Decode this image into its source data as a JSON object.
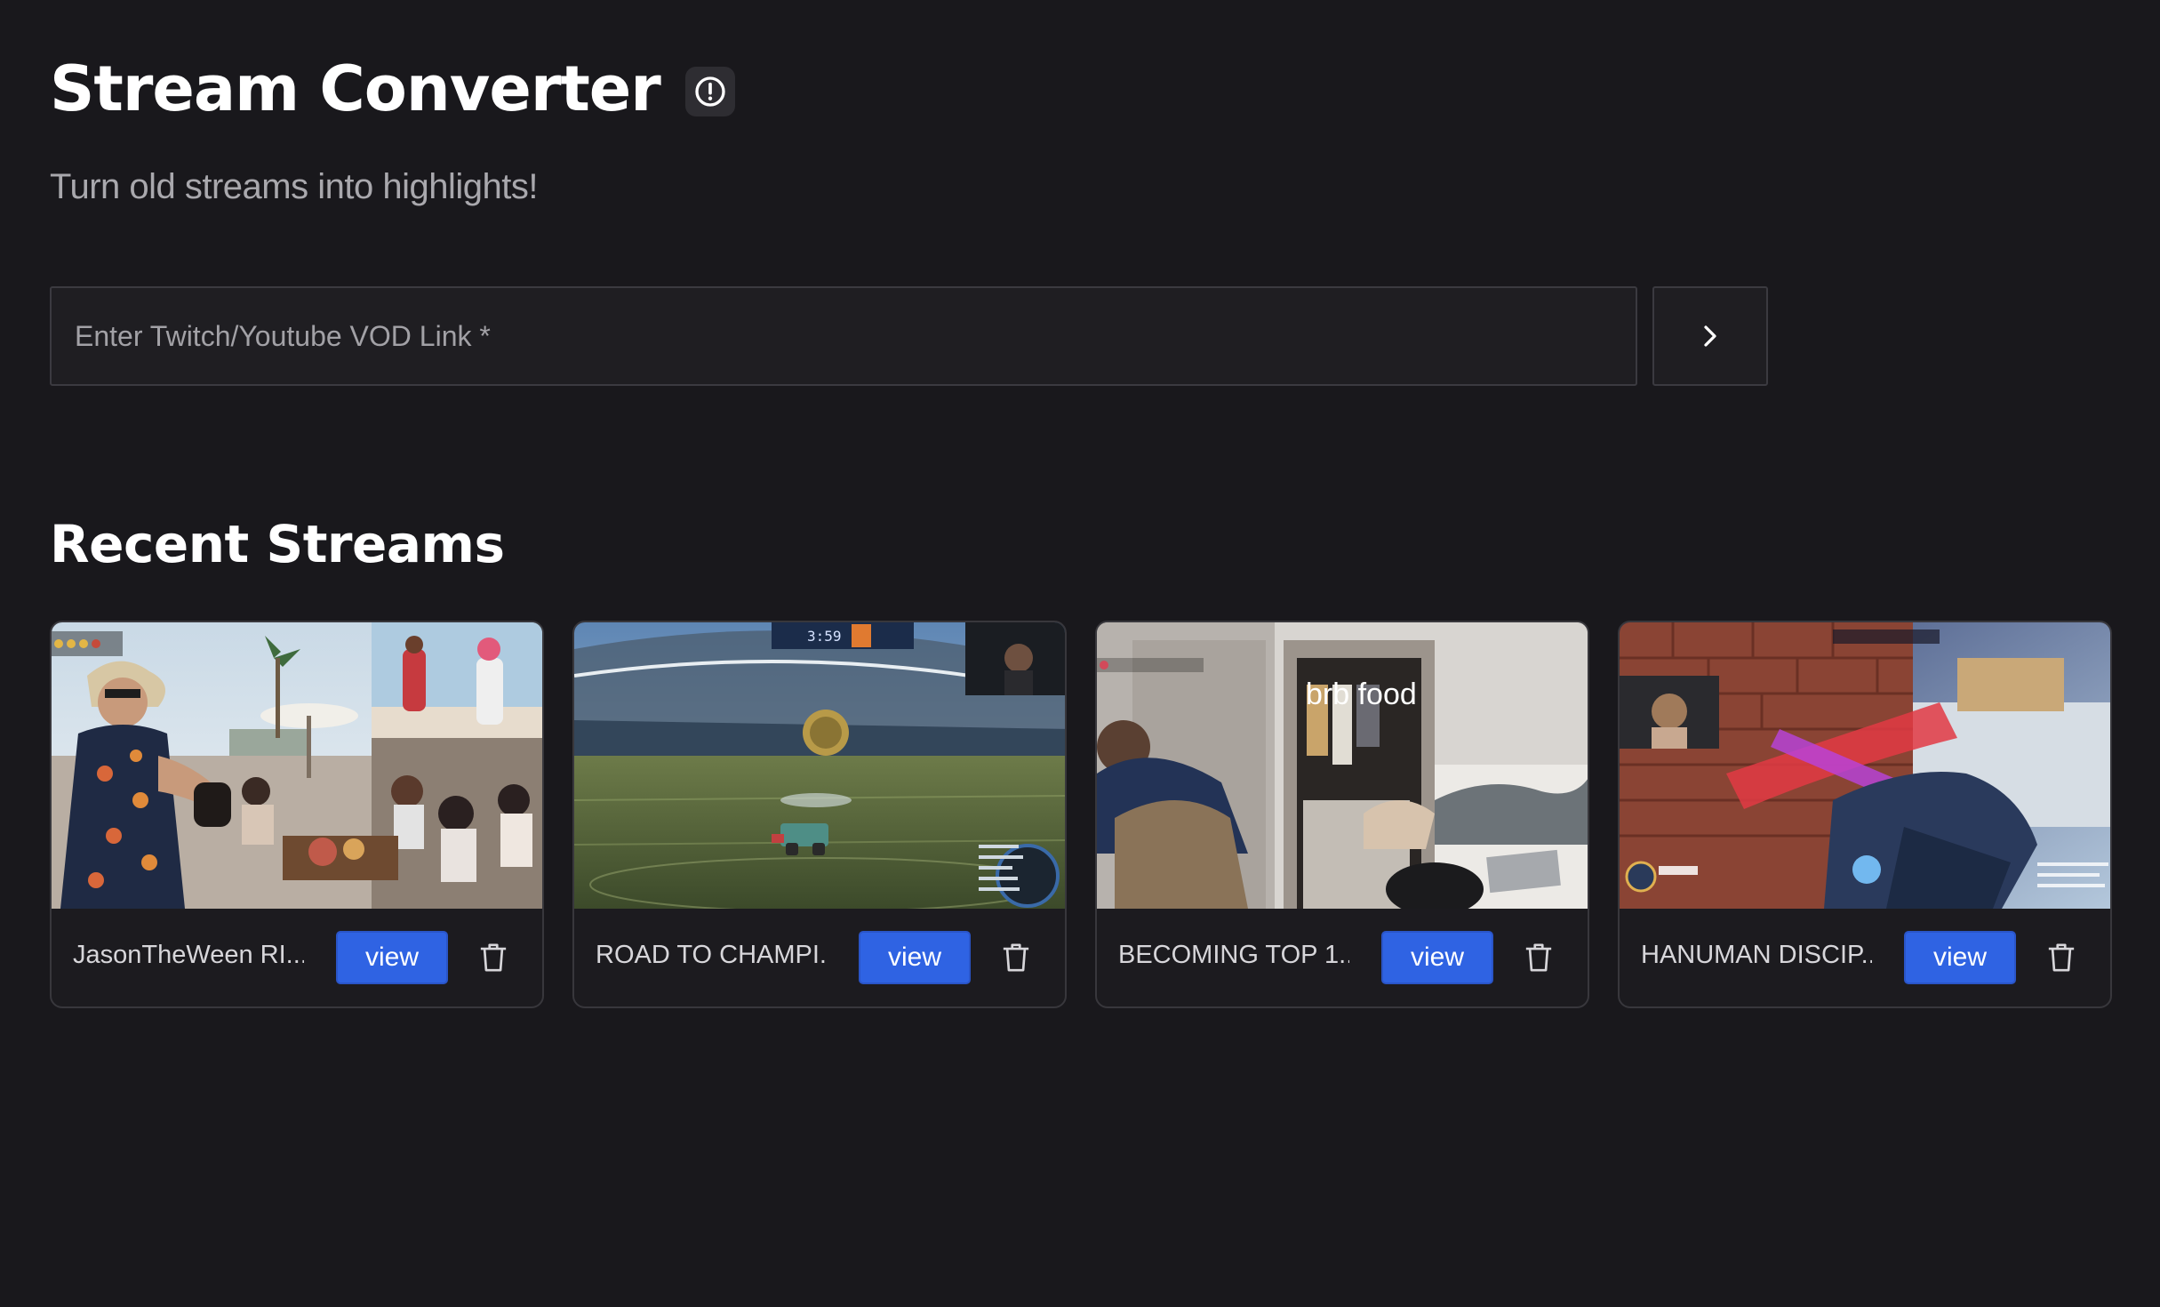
{
  "header": {
    "title": "Stream Converter",
    "subtitle": "Turn old streams into highlights!",
    "info_icon": "info-circle-icon"
  },
  "search": {
    "placeholder": "Enter Twitch/Youtube VOD Link *",
    "value": "",
    "submit_icon": "chevron-right-icon"
  },
  "recent": {
    "title": "Recent Streams",
    "streams": [
      {
        "title": "JasonTheWeen RI...",
        "view_label": "view",
        "delete_icon": "trash-icon"
      },
      {
        "title": "ROAD TO CHAMPI...",
        "view_label": "view",
        "delete_icon": "trash-icon",
        "overlay_score": "3:59"
      },
      {
        "title": "BECOMING TOP 1...",
        "view_label": "view",
        "delete_icon": "trash-icon",
        "overlay_text": "brb food"
      },
      {
        "title": "HANUMAN DISCIP...",
        "view_label": "view",
        "delete_icon": "trash-icon"
      }
    ]
  },
  "colors": {
    "background": "#19181c",
    "card": "#1c1b1f",
    "border": "#38373c",
    "accent": "#2f63e3",
    "muted_text": "#a9a8ad"
  }
}
